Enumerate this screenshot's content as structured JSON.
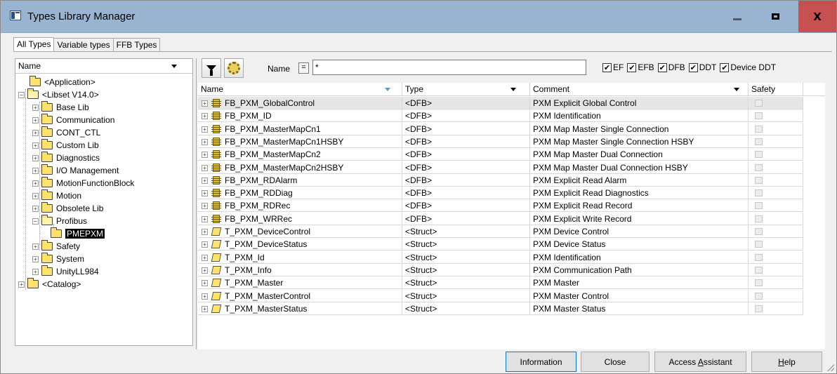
{
  "window": {
    "title": "Types Library Manager",
    "controls": {
      "minimize": "—",
      "maximize": "□",
      "close": "X"
    }
  },
  "tabs": [
    {
      "label": "All Types",
      "active": true
    },
    {
      "label": "Variable types",
      "active": false
    },
    {
      "label": "FFB Types",
      "active": false
    }
  ],
  "tree": {
    "header": "Name",
    "items": [
      {
        "label": "<Application>",
        "expander": "",
        "open": false
      },
      {
        "label": "<Libset V14.0>",
        "expander": "−",
        "open": true
      },
      {
        "label": "Base Lib",
        "expander": "+",
        "open": false
      },
      {
        "label": "Communication",
        "expander": "+",
        "open": false
      },
      {
        "label": "CONT_CTL",
        "expander": "+",
        "open": false
      },
      {
        "label": "Custom Lib",
        "expander": "+",
        "open": false
      },
      {
        "label": "Diagnostics",
        "expander": "+",
        "open": false
      },
      {
        "label": "I/O Management",
        "expander": "+",
        "open": false
      },
      {
        "label": "MotionFunctionBlock",
        "expander": "+",
        "open": false
      },
      {
        "label": "Motion",
        "expander": "+",
        "open": false
      },
      {
        "label": "Obsolete Lib",
        "expander": "+",
        "open": false
      },
      {
        "label": "Profibus",
        "expander": "−",
        "open": true
      },
      {
        "label": "PMEPXM",
        "expander": "",
        "open": false,
        "selected": true
      },
      {
        "label": "Safety",
        "expander": "+",
        "open": false
      },
      {
        "label": "System",
        "expander": "+",
        "open": false
      },
      {
        "label": "UnityLL984",
        "expander": "+",
        "open": false
      },
      {
        "label": "<Catalog>",
        "expander": "+",
        "open": false
      }
    ]
  },
  "filter": {
    "name_label": "Name",
    "eq_symbol": "=",
    "name_value": "*",
    "checkboxes": [
      {
        "label": "EF",
        "checked": true
      },
      {
        "label": "EFB",
        "checked": true
      },
      {
        "label": "DFB",
        "checked": true
      },
      {
        "label": "DDT",
        "checked": true
      },
      {
        "label": "Device DDT",
        "checked": true
      }
    ]
  },
  "grid": {
    "headers": {
      "name": "Name",
      "type": "Type",
      "comment": "Comment",
      "safety": "Safety"
    },
    "rows": [
      {
        "name": "FB_PXM_GlobalControl",
        "type": "<DFB>",
        "comment": "PXM Explicit Global Control",
        "kind": "dfb"
      },
      {
        "name": "FB_PXM_ID",
        "type": "<DFB>",
        "comment": "PXM Identification",
        "kind": "dfb"
      },
      {
        "name": "FB_PXM_MasterMapCn1",
        "type": "<DFB>",
        "comment": "PXM Map Master Single Connection",
        "kind": "dfb"
      },
      {
        "name": "FB_PXM_MasterMapCn1HSBY",
        "type": "<DFB>",
        "comment": "PXM Map Master Single Connection HSBY",
        "kind": "dfb"
      },
      {
        "name": "FB_PXM_MasterMapCn2",
        "type": "<DFB>",
        "comment": "PXM Map Master Dual Connection",
        "kind": "dfb"
      },
      {
        "name": "FB_PXM_MasterMapCn2HSBY",
        "type": "<DFB>",
        "comment": "PXM Map Master Dual Connection HSBY",
        "kind": "dfb"
      },
      {
        "name": "FB_PXM_RDAlarm",
        "type": "<DFB>",
        "comment": "PXM Explicit Read Alarm",
        "kind": "dfb"
      },
      {
        "name": "FB_PXM_RDDiag",
        "type": "<DFB>",
        "comment": "PXM Explicit Read Diagnostics",
        "kind": "dfb"
      },
      {
        "name": "FB_PXM_RDRec",
        "type": "<DFB>",
        "comment": "PXM Explicit Read Record",
        "kind": "dfb"
      },
      {
        "name": "FB_PXM_WRRec",
        "type": "<DFB>",
        "comment": "PXM Explicit Write Record",
        "kind": "dfb"
      },
      {
        "name": "T_PXM_DeviceControl",
        "type": "<Struct>",
        "comment": "PXM Device Control",
        "kind": "struct"
      },
      {
        "name": "T_PXM_DeviceStatus",
        "type": "<Struct>",
        "comment": "PXM Device Status",
        "kind": "struct"
      },
      {
        "name": "T_PXM_Id",
        "type": "<Struct>",
        "comment": "PXM Identification",
        "kind": "struct"
      },
      {
        "name": "T_PXM_Info",
        "type": "<Struct>",
        "comment": "PXM Communication Path",
        "kind": "struct"
      },
      {
        "name": "T_PXM_Master",
        "type": "<Struct>",
        "comment": "PXM Master",
        "kind": "struct"
      },
      {
        "name": "T_PXM_MasterControl",
        "type": "<Struct>",
        "comment": "PXM Master Control",
        "kind": "struct"
      },
      {
        "name": "T_PXM_MasterStatus",
        "type": "<Struct>",
        "comment": "PXM Master Status",
        "kind": "struct"
      }
    ]
  },
  "buttons": {
    "information": "Information",
    "close": "Close",
    "access_assistant_pre": "Access ",
    "access_assistant_u": "A",
    "access_assistant_post": "ssistant",
    "help_u": "H",
    "help_post": "elp"
  }
}
